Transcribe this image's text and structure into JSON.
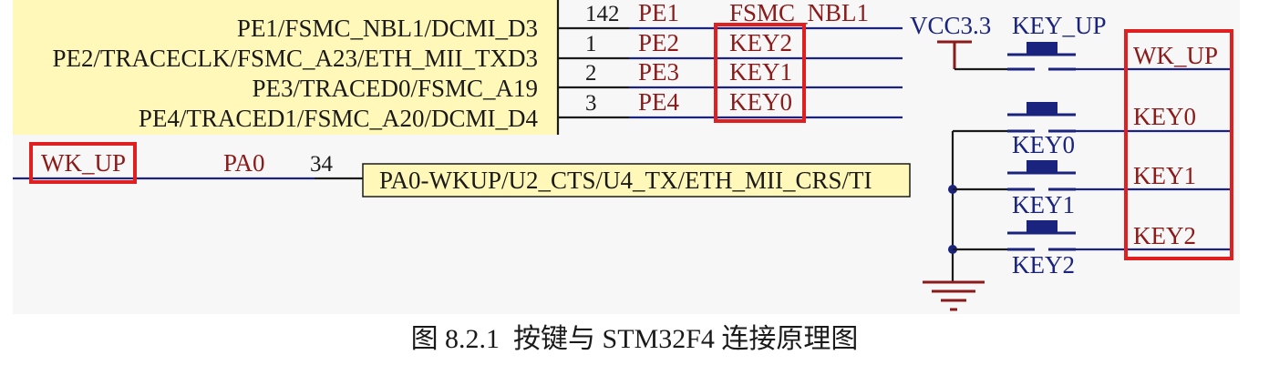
{
  "diagram": {
    "chip_pins": [
      {
        "name": "PE1/FSMC_NBL1/DCMI_D3",
        "pin": "142",
        "port": "PE1",
        "net": "FSMC_NBL1"
      },
      {
        "name": "PE2/TRACECLK/FSMC_A23/ETH_MII_TXD3",
        "pin": "1",
        "port": "PE2",
        "net": "KEY2"
      },
      {
        "name": "PE3/TRACED0/FSMC_A19",
        "pin": "2",
        "port": "PE3",
        "net": "KEY1"
      },
      {
        "name": "PE4/TRACED1/FSMC_A20/DCMI_D4",
        "pin": "3",
        "port": "PE4",
        "net": "KEY0"
      }
    ],
    "pa0": {
      "net": "WK_UP",
      "port": "PA0",
      "pin": "34",
      "name": "PA0-WKUP/U2_CTS/U4_TX/ETH_MII_CRS/TI"
    },
    "vcc_label": "VCC3.3",
    "keys": [
      {
        "switch": "KEY_UP",
        "net": "WK_UP"
      },
      {
        "switch": "KEY0",
        "net": "KEY0"
      },
      {
        "switch": "KEY1",
        "net": "KEY1"
      },
      {
        "switch": "KEY2",
        "net": "KEY2"
      }
    ],
    "colors": {
      "chip_fill": "#fff8b8",
      "wire": "#1a237e",
      "highlight": "#e02020",
      "net_text": "#8b1a1a"
    }
  },
  "caption": "图 8.2.1  按键与 STM32F4 连接原理图"
}
